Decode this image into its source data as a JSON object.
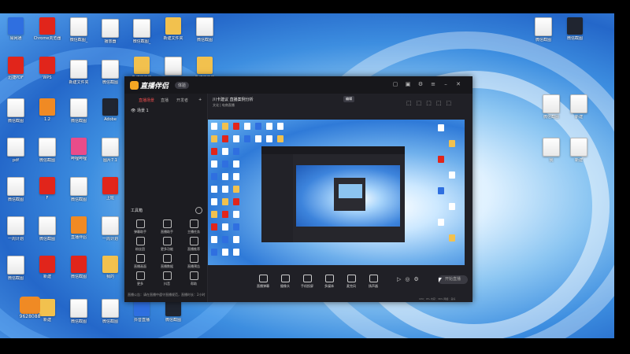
{
  "desktop": {
    "icons": [
      {
        "label": "易网通",
        "type": "blue"
      },
      {
        "label": "Chrome浏览器",
        "type": "red"
      },
      {
        "label": "微信截图_",
        "type": "doc"
      },
      {
        "label": "播放器",
        "type": "doc"
      },
      {
        "label": "微信截图_",
        "type": "doc"
      },
      {
        "label": "新建文件夹",
        "type": "folder"
      },
      {
        "label": "微信截图",
        "type": "doc"
      },
      {
        "label": "迅捷PDF",
        "type": "red"
      },
      {
        "label": "WPS",
        "type": "red"
      },
      {
        "label": "新建文件夹",
        "type": "doc"
      },
      {
        "label": "微信截图",
        "type": "doc"
      },
      {
        "label": "新建文件夹",
        "type": "folder"
      },
      {
        "label": "微信截图",
        "type": "doc"
      },
      {
        "label": "新建文件夹",
        "type": "folder"
      },
      {
        "label": "微信截图",
        "type": "doc"
      },
      {
        "label": "1.2",
        "type": "orange"
      },
      {
        "label": "微信截图",
        "type": "doc"
      },
      {
        "label": "Adobe",
        "type": "dark"
      },
      {
        "label": "pdf",
        "type": "doc"
      },
      {
        "label": "微信截图",
        "type": "doc"
      },
      {
        "label": "哔哩哔哩",
        "type": "pink"
      },
      {
        "label": "图片7.1",
        "type": "doc"
      },
      {
        "label": "微信截图",
        "type": "doc"
      },
      {
        "label": "F",
        "type": "red"
      },
      {
        "label": "微信截图",
        "type": "doc"
      },
      {
        "label": "上班",
        "type": "red"
      },
      {
        "label": "一周计划",
        "type": "doc"
      },
      {
        "label": "微信截图",
        "type": "doc"
      },
      {
        "label": "直播伴侣",
        "type": "orange"
      },
      {
        "label": "一周计划",
        "type": "doc"
      },
      {
        "label": "微信截图",
        "type": "doc"
      },
      {
        "label": "新建",
        "type": "red"
      },
      {
        "label": "微信截图",
        "type": "red"
      },
      {
        "label": "我的",
        "type": "folder"
      },
      {
        "label": "新建",
        "type": "folder"
      },
      {
        "label": "微信截图",
        "type": "doc"
      },
      {
        "label": "微信截图",
        "type": "doc"
      },
      {
        "label": "抖音直播",
        "type": "blue"
      },
      {
        "label": "微信截图",
        "type": "dark"
      },
      {
        "label": "微信截图",
        "type": "doc"
      },
      {
        "label": "微信截图",
        "type": "dark"
      },
      {
        "label": "微信截图",
        "type": "doc"
      },
      {
        "label": "新建",
        "type": "doc"
      },
      {
        "label": "我",
        "type": "doc"
      },
      {
        "label": "新建",
        "type": "doc"
      }
    ],
    "user_badge": "9628088"
  },
  "app": {
    "name": "直播伴侣",
    "badge": "体验",
    "sidebar": {
      "tabs": [
        "直播场景",
        "直播",
        "开发者"
      ],
      "scene": "场景 1",
      "tools_title": "工具箱",
      "tools": [
        "弹幕助手",
        "直播助手",
        "主播任务",
        "粉丝团",
        "更多功能",
        "直播推荐",
        "直播画面",
        "直播数据",
        "直播预告",
        "更多",
        "抖音",
        "帮助"
      ],
      "footer": "直播公告：请在直播中遵守直播规范，直播时长：2小时"
    },
    "main": {
      "title": "川卡建议 直播案例分析",
      "subtitle": "文化 | 电商直播",
      "edit_badge": "编辑"
    },
    "toolbar": {
      "buttons": [
        "直播弹幕",
        "摄像头",
        "手机投屏",
        "多媒体",
        "麦克风",
        "扬声器"
      ],
      "start": "开始直播",
      "status": "CPU：8% 内存：36% 网络：良好"
    }
  }
}
